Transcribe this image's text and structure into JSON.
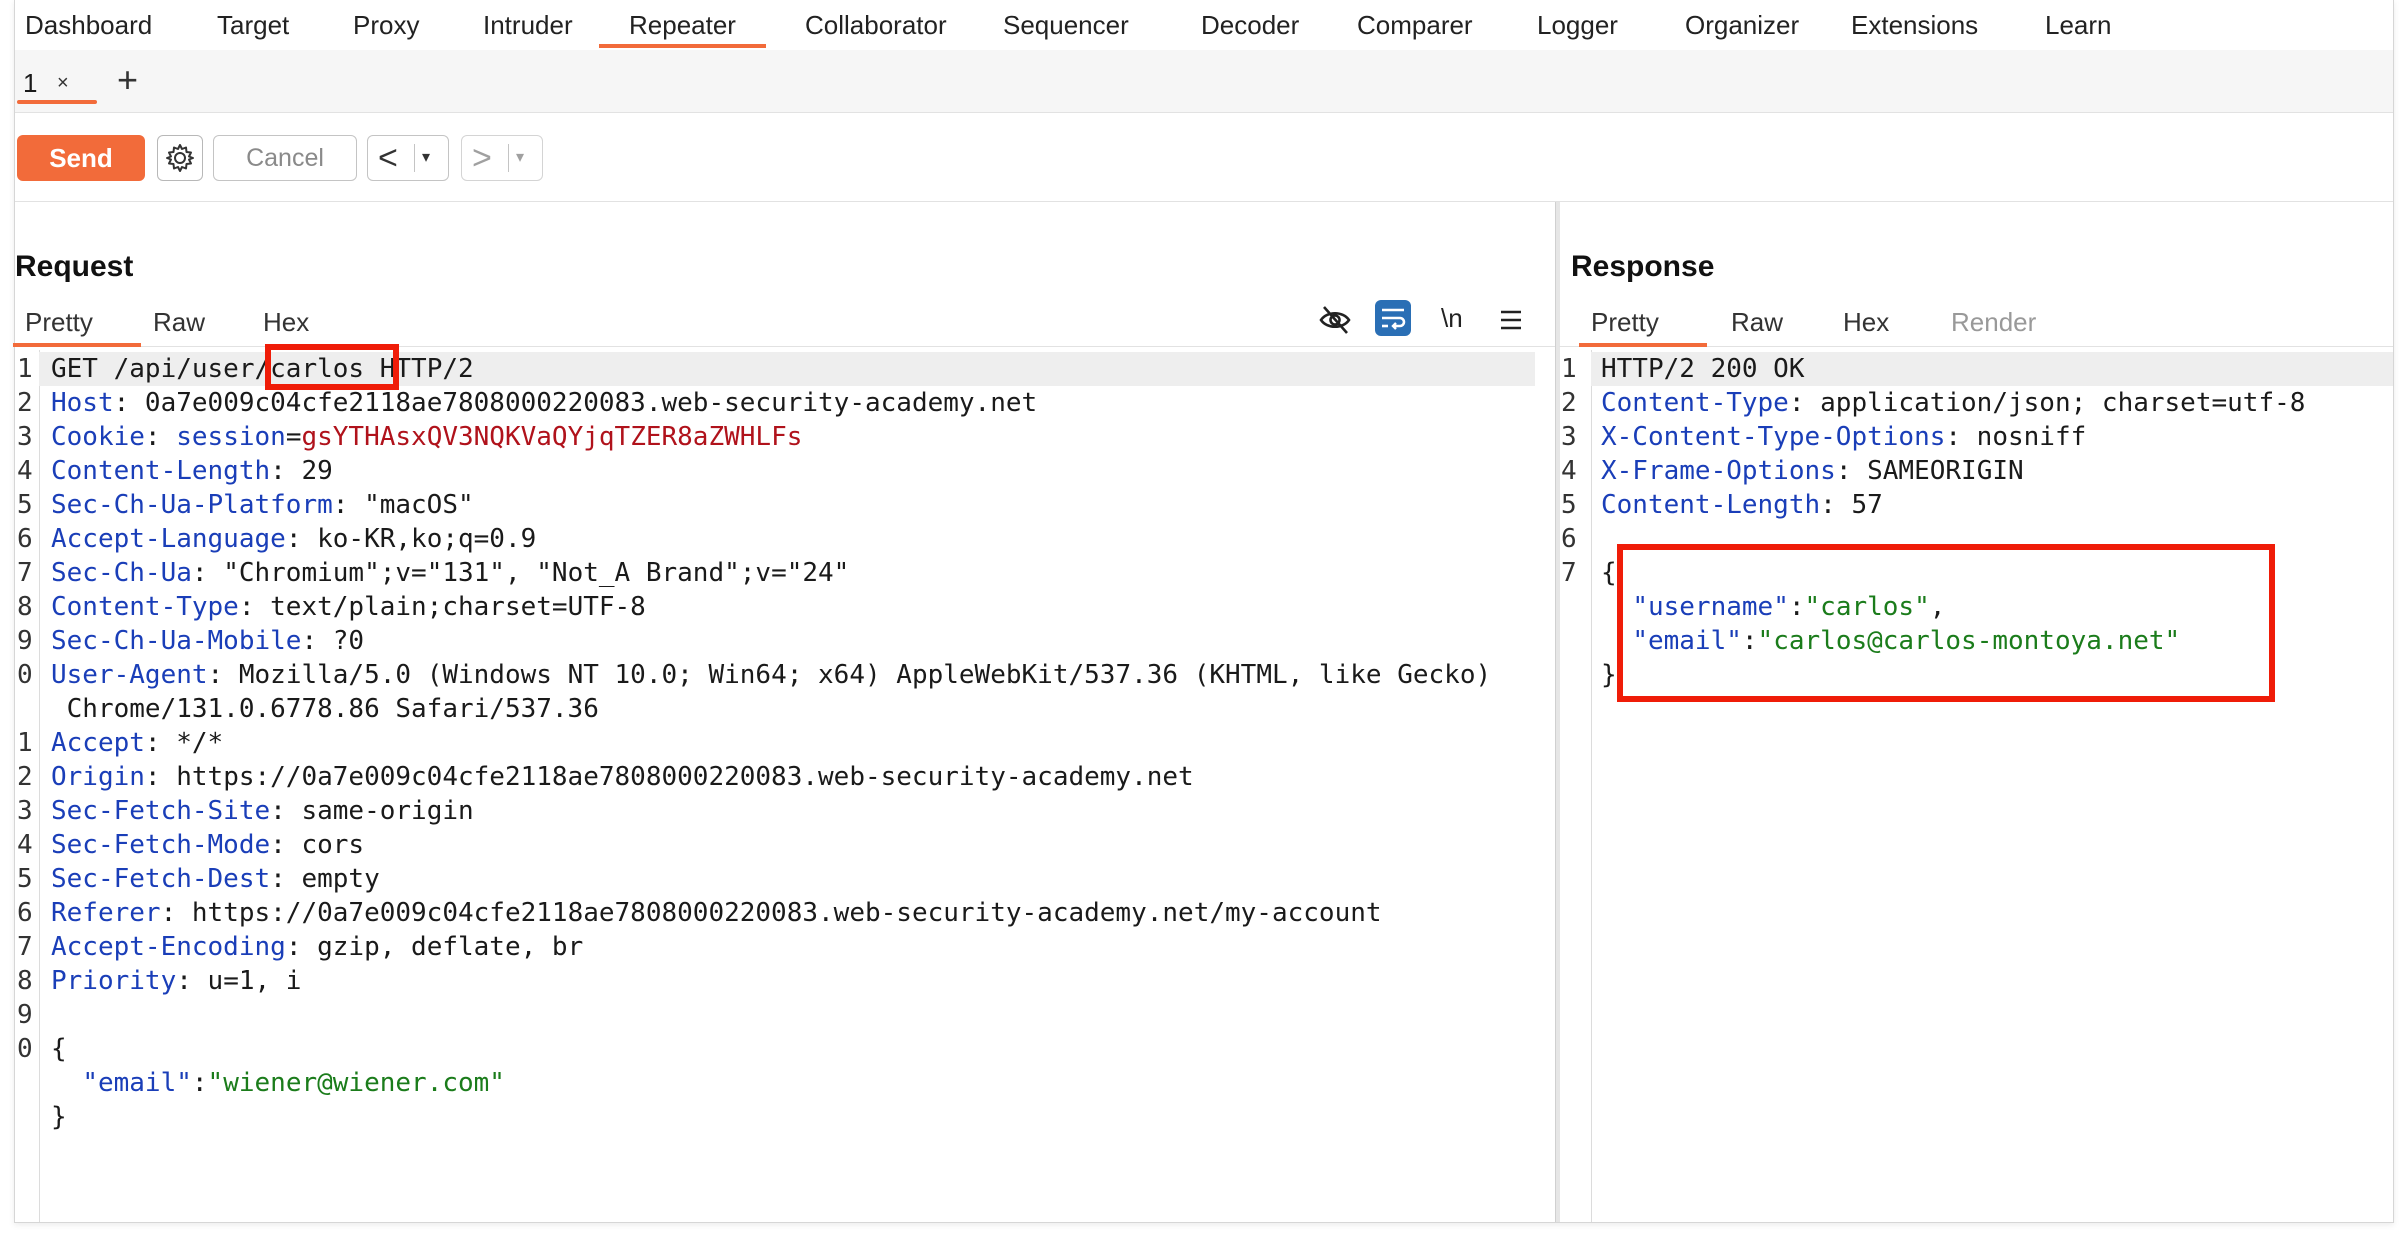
{
  "nav": [
    "Dashboard",
    "Target",
    "Proxy",
    "Intruder",
    "Repeater",
    "Collaborator",
    "Sequencer",
    "Decoder",
    "Comparer",
    "Logger",
    "Organizer",
    "Extensions",
    "Learn"
  ],
  "active_nav": "Repeater",
  "tab": {
    "label": "1",
    "close": "×",
    "add": "+"
  },
  "toolbar": {
    "send": "Send",
    "cancel": "Cancel",
    "back": "<",
    "forward": ">",
    "dropdown": "▾"
  },
  "request": {
    "title": "Request",
    "tabs": [
      "Pretty",
      "Raw",
      "Hex"
    ],
    "icons": [
      "hide-icon",
      "wrap-icon",
      "newline-icon",
      "menu-icon"
    ],
    "newline_label": "\\n",
    "lines": [
      {
        "n": "1",
        "parts": [
          [
            "val",
            "GET /api/user/"
          ],
          [
            "val",
            "carlos"
          ],
          [
            "val",
            " HTTP/2"
          ]
        ]
      },
      {
        "n": "2",
        "parts": [
          [
            "hdr",
            "Host"
          ],
          [
            "val",
            ": 0a7e009c04cfe2118ae7808000220083.web-security-academy.net"
          ]
        ]
      },
      {
        "n": "3",
        "parts": [
          [
            "hdr",
            "Cookie"
          ],
          [
            "val",
            ": "
          ],
          [
            "hdr",
            "session"
          ],
          [
            "val",
            "="
          ],
          [
            "cookie",
            "gsYTHAsxQV3NQKVaQYjqTZER8aZWHLFs"
          ]
        ]
      },
      {
        "n": "4",
        "parts": [
          [
            "hdr",
            "Content-Length"
          ],
          [
            "val",
            ": 29"
          ]
        ]
      },
      {
        "n": "5",
        "parts": [
          [
            "hdr",
            "Sec-Ch-Ua-Platform"
          ],
          [
            "val",
            ": \"macOS\""
          ]
        ]
      },
      {
        "n": "6",
        "parts": [
          [
            "hdr",
            "Accept-Language"
          ],
          [
            "val",
            ": ko-KR,ko;q=0.9"
          ]
        ]
      },
      {
        "n": "7",
        "parts": [
          [
            "hdr",
            "Sec-Ch-Ua"
          ],
          [
            "val",
            ": \"Chromium\";v=\"131\", \"Not_A Brand\";v=\"24\""
          ]
        ]
      },
      {
        "n": "8",
        "parts": [
          [
            "hdr",
            "Content-Type"
          ],
          [
            "val",
            ": text/plain;charset=UTF-8"
          ]
        ]
      },
      {
        "n": "9",
        "parts": [
          [
            "hdr",
            "Sec-Ch-Ua-Mobile"
          ],
          [
            "val",
            ": ?0"
          ]
        ]
      },
      {
        "n": "0",
        "parts": [
          [
            "hdr",
            "User-Agent"
          ],
          [
            "val",
            ": Mozilla/5.0 (Windows NT 10.0; Win64; x64) AppleWebKit/537.36 (KHTML, like Gecko)"
          ]
        ]
      },
      {
        "n": "",
        "parts": [
          [
            "val",
            " Chrome/131.0.6778.86 Safari/537.36"
          ]
        ]
      },
      {
        "n": "1",
        "parts": [
          [
            "hdr",
            "Accept"
          ],
          [
            "val",
            ": */*"
          ]
        ]
      },
      {
        "n": "2",
        "parts": [
          [
            "hdr",
            "Origin"
          ],
          [
            "val",
            ": https://0a7e009c04cfe2118ae7808000220083.web-security-academy.net"
          ]
        ]
      },
      {
        "n": "3",
        "parts": [
          [
            "hdr",
            "Sec-Fetch-Site"
          ],
          [
            "val",
            ": same-origin"
          ]
        ]
      },
      {
        "n": "4",
        "parts": [
          [
            "hdr",
            "Sec-Fetch-Mode"
          ],
          [
            "val",
            ": cors"
          ]
        ]
      },
      {
        "n": "5",
        "parts": [
          [
            "hdr",
            "Sec-Fetch-Dest"
          ],
          [
            "val",
            ": empty"
          ]
        ]
      },
      {
        "n": "6",
        "parts": [
          [
            "hdr",
            "Referer"
          ],
          [
            "val",
            ": https://0a7e009c04cfe2118ae7808000220083.web-security-academy.net/my-account"
          ]
        ]
      },
      {
        "n": "7",
        "parts": [
          [
            "hdr",
            "Accept-Encoding"
          ],
          [
            "val",
            ": gzip, deflate, br"
          ]
        ]
      },
      {
        "n": "8",
        "parts": [
          [
            "hdr",
            "Priority"
          ],
          [
            "val",
            ": u=1, i"
          ]
        ]
      },
      {
        "n": "9",
        "parts": [
          [
            "val",
            ""
          ]
        ]
      },
      {
        "n": "0",
        "parts": [
          [
            "val",
            "{"
          ]
        ]
      },
      {
        "n": "",
        "parts": [
          [
            "val",
            "  "
          ],
          [
            "hdr",
            "\"email\""
          ],
          [
            "val",
            ":"
          ],
          [
            "str",
            "\"wiener@wiener.com\""
          ]
        ]
      },
      {
        "n": "",
        "parts": [
          [
            "val",
            "}"
          ]
        ]
      }
    ]
  },
  "response": {
    "title": "Response",
    "tabs": [
      "Pretty",
      "Raw",
      "Hex",
      "Render"
    ],
    "lines": [
      {
        "n": "1",
        "parts": [
          [
            "val",
            "HTTP/2 200 OK"
          ]
        ]
      },
      {
        "n": "2",
        "parts": [
          [
            "hdr",
            "Content-Type"
          ],
          [
            "val",
            ": application/json; charset=utf-8"
          ]
        ]
      },
      {
        "n": "3",
        "parts": [
          [
            "hdr",
            "X-Content-Type-Options"
          ],
          [
            "val",
            ": nosniff"
          ]
        ]
      },
      {
        "n": "4",
        "parts": [
          [
            "hdr",
            "X-Frame-Options"
          ],
          [
            "val",
            ": SAMEORIGIN"
          ]
        ]
      },
      {
        "n": "5",
        "parts": [
          [
            "hdr",
            "Content-Length"
          ],
          [
            "val",
            ": 57"
          ]
        ]
      },
      {
        "n": "6",
        "parts": [
          [
            "val",
            ""
          ]
        ]
      },
      {
        "n": "7",
        "parts": [
          [
            "val",
            "{"
          ]
        ]
      },
      {
        "n": "",
        "parts": [
          [
            "val",
            "  "
          ],
          [
            "hdr",
            "\"username\""
          ],
          [
            "val",
            ":"
          ],
          [
            "str",
            "\"carlos\""
          ],
          [
            "val",
            ","
          ]
        ]
      },
      {
        "n": "",
        "parts": [
          [
            "val",
            "  "
          ],
          [
            "hdr",
            "\"email\""
          ],
          [
            "val",
            ":"
          ],
          [
            "str",
            "\"carlos@carlos-montoya.net\""
          ]
        ]
      },
      {
        "n": "",
        "parts": [
          [
            "val",
            "}"
          ]
        ]
      }
    ]
  },
  "colors": {
    "accent": "#f26b3a",
    "highlight_box": "#ef1c08",
    "header_name": "#1a3eb8",
    "string": "#1b7c1b",
    "cookie_value": "#b0121b"
  }
}
